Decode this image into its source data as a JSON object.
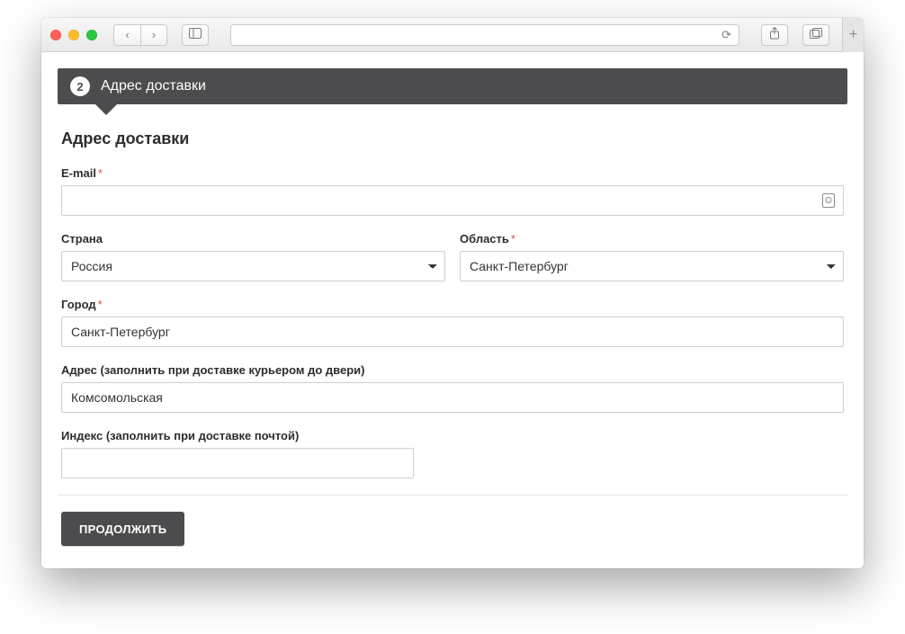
{
  "browser": {
    "back_glyph": "‹",
    "forward_glyph": "›",
    "sidebar_glyph": "▯▯",
    "tabs_glyph": "⧉",
    "reload_glyph": "⟳",
    "share_glyph": "⇪",
    "tabsexpose_glyph": "⧉",
    "newtab_glyph": "+"
  },
  "step": {
    "number": "2",
    "title": "Адрес доставки"
  },
  "form": {
    "section_title": "Адрес доставки",
    "email_label": "E-mail",
    "email_required": "*",
    "email_value": "",
    "country_label": "Страна",
    "country_value": "Россия",
    "region_label": "Область",
    "region_required": "*",
    "region_value": "Санкт-Петербург",
    "city_label": "Город",
    "city_required": "*",
    "city_value": "Санкт-Петербург",
    "address_label": "Адрес (заполнить при доставке курьером до двери)",
    "address_value": "Комсомольская",
    "zip_label": "Индекс (заполнить при доставке почтой)",
    "zip_value": "",
    "continue_label": "ПРОДОЛЖИТЬ"
  }
}
